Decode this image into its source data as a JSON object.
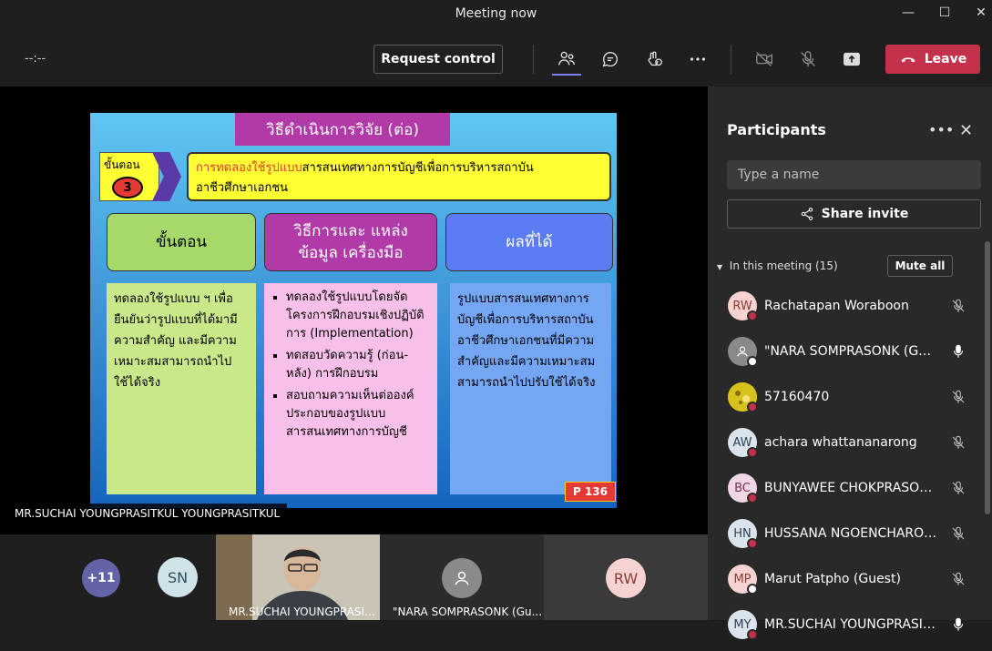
{
  "window": {
    "title": "Meeting now"
  },
  "toolbar": {
    "timer": "--:--",
    "request_control": "Request control",
    "leave": "Leave"
  },
  "slide": {
    "title": "วิธีดำเนินการวิจัย (ต่อ)",
    "step_label": "ขั้นตอน",
    "step_number": "3",
    "heading_red": "การทดลองใช้รูปแบบ",
    "heading_rest": "สารสนเทศทางการบัญชีเพื่อการบริหารสถาบัน",
    "heading_line2": "อาชีวศึกษาเอกชน",
    "columns": [
      {
        "head": "ขั้นตอน",
        "color": "#a6d96a"
      },
      {
        "head": "วิธีการและ แหล่งข้อมูล เครื่องมือ",
        "color": "#b23aa8"
      },
      {
        "head": "ผลที่ได้",
        "color": "#5b7cf2"
      }
    ],
    "col1_body": "ทดลองใช้รูปแบบ ฯ เพื่อยืนยันว่ารูปแบบที่ได้มามีความสำคัญ และมีความเหมาะสมสามารถนำไปใช้ได้จริง",
    "col2_items": [
      "ทดลองใช้รูปแบบโดยจัดโครงการฝึกอบรมเชิงปฏิบัติการ (Implementation)",
      "ทดสอบวัดความรู้ (ก่อน-หลัง) การฝึกอบรม",
      "สอบถามความเห็นต่อองค์ประกอบของรูปแบบสารสนเทศทางการบัญชี"
    ],
    "col3_body": "รูปแบบสารสนเทศทางการบัญชีเพื่อการบริหารสถาบันอาชีวศึกษาเอกชนที่มีความสำคัญและมีความเหมาะสมสามารถนำไปปรับใช้ได้จริง",
    "page_tag": "P 136"
  },
  "stage": {
    "presenter_name": "MR.SUCHAI YOUNGPRASITKUL YOUNGPRASITKUL"
  },
  "strip": {
    "overflow_count": "+11",
    "sn_initials": "SN",
    "tile_presenter_name": "MR.SUCHAI YOUNGPRASI...",
    "tile_guest_name": "\"NARA SOMPRASONK (Gu...",
    "rw_initials": "RW"
  },
  "panel": {
    "title": "Participants",
    "search_placeholder": "Type a name",
    "share_invite": "Share invite",
    "in_meeting": "In this meeting (15)",
    "mute_all": "Mute all",
    "participants": [
      {
        "initials": "RW",
        "name": "Rachatapan Woraboon",
        "bg": "#f6d3d0",
        "fg": "#8a3b34",
        "status": "#c4314b",
        "muted": true
      },
      {
        "initials": "",
        "name": "\"NARA SOMPRASONK (Guest)\"",
        "bg": "#8a8a8a",
        "fg": "#fff",
        "status": "#ffffff",
        "muted": false
      },
      {
        "initials": "",
        "name": "57160470",
        "bg": "#d6c21a",
        "fg": "#333",
        "status": "#c4314b",
        "muted": true
      },
      {
        "initials": "AW",
        "name": "achara whattananarong",
        "bg": "#dbe4ec",
        "fg": "#2b4256",
        "status": "#c4314b",
        "muted": true
      },
      {
        "initials": "BC",
        "name": "BUNYAWEE CHOKPRASOETS...",
        "bg": "#f0d7e6",
        "fg": "#7a2d5a",
        "status": "#c4314b",
        "muted": true
      },
      {
        "initials": "HN",
        "name": "HUSSANA NGOENCHAROEN",
        "bg": "#dbe4ec",
        "fg": "#2b4256",
        "status": "#c4314b",
        "muted": true
      },
      {
        "initials": "MP",
        "name": "Marut Patpho (Guest)",
        "bg": "#f6d3d0",
        "fg": "#8a3b34",
        "status": "#ffffff",
        "muted": true
      },
      {
        "initials": "MY",
        "name": "MR.SUCHAI YOUNGPRASITK...",
        "bg": "#dbe4ec",
        "fg": "#2b4256",
        "status": "#c4314b",
        "muted": false
      }
    ]
  }
}
